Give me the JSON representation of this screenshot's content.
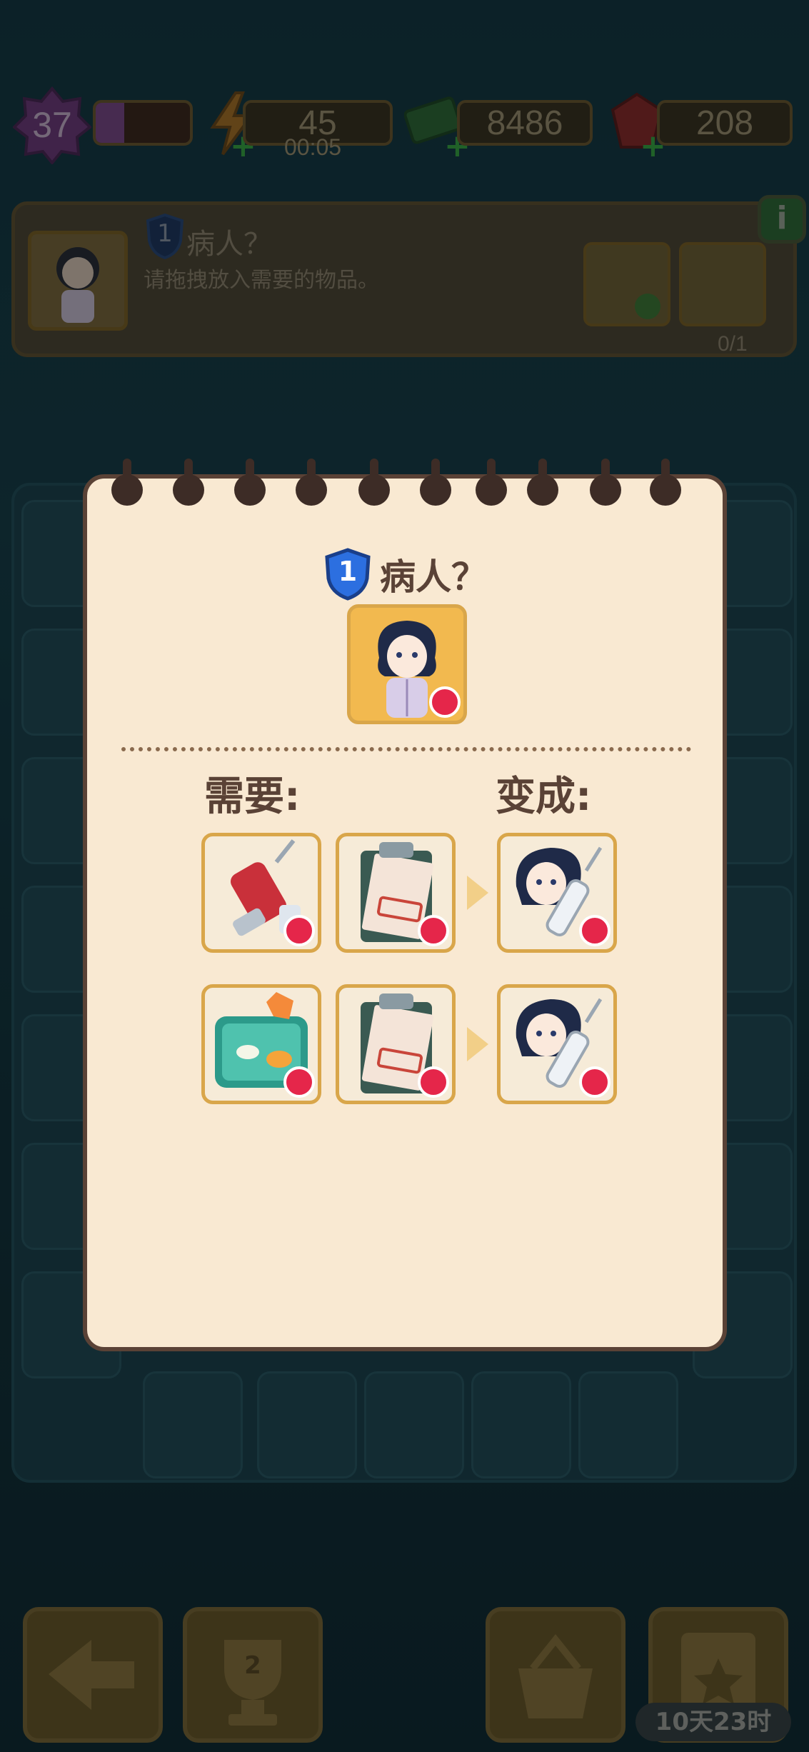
{
  "hud": {
    "level": "37",
    "energy": "45",
    "energy_timer": "00:05",
    "cash": "8486",
    "gems": "208"
  },
  "task": {
    "level_badge": "1",
    "title": "病人？",
    "description": "请拖拽放入需要的物品。",
    "info_label": "i",
    "progress": "0/1"
  },
  "notebook": {
    "level_badge": "1",
    "title": "病人？",
    "need_label": "需要:",
    "become_label": "变成:",
    "recipes": [
      {
        "items": [
          "blood-vial-item",
          "deny-clipboard-item"
        ],
        "result": "patient-with-syringe"
      },
      {
        "items": [
          "pill-tray-item",
          "deny-clipboard-item"
        ],
        "result": "patient-with-syringe"
      }
    ]
  },
  "bottom": {
    "trophy_count": "2",
    "timer": "10天23时"
  },
  "colors": {
    "paper": "#f9e9d2",
    "ink": "#5a4236",
    "card_border": "#d9a64a",
    "crown_badge": "#e5264a",
    "shield": "#2c6fe0"
  }
}
